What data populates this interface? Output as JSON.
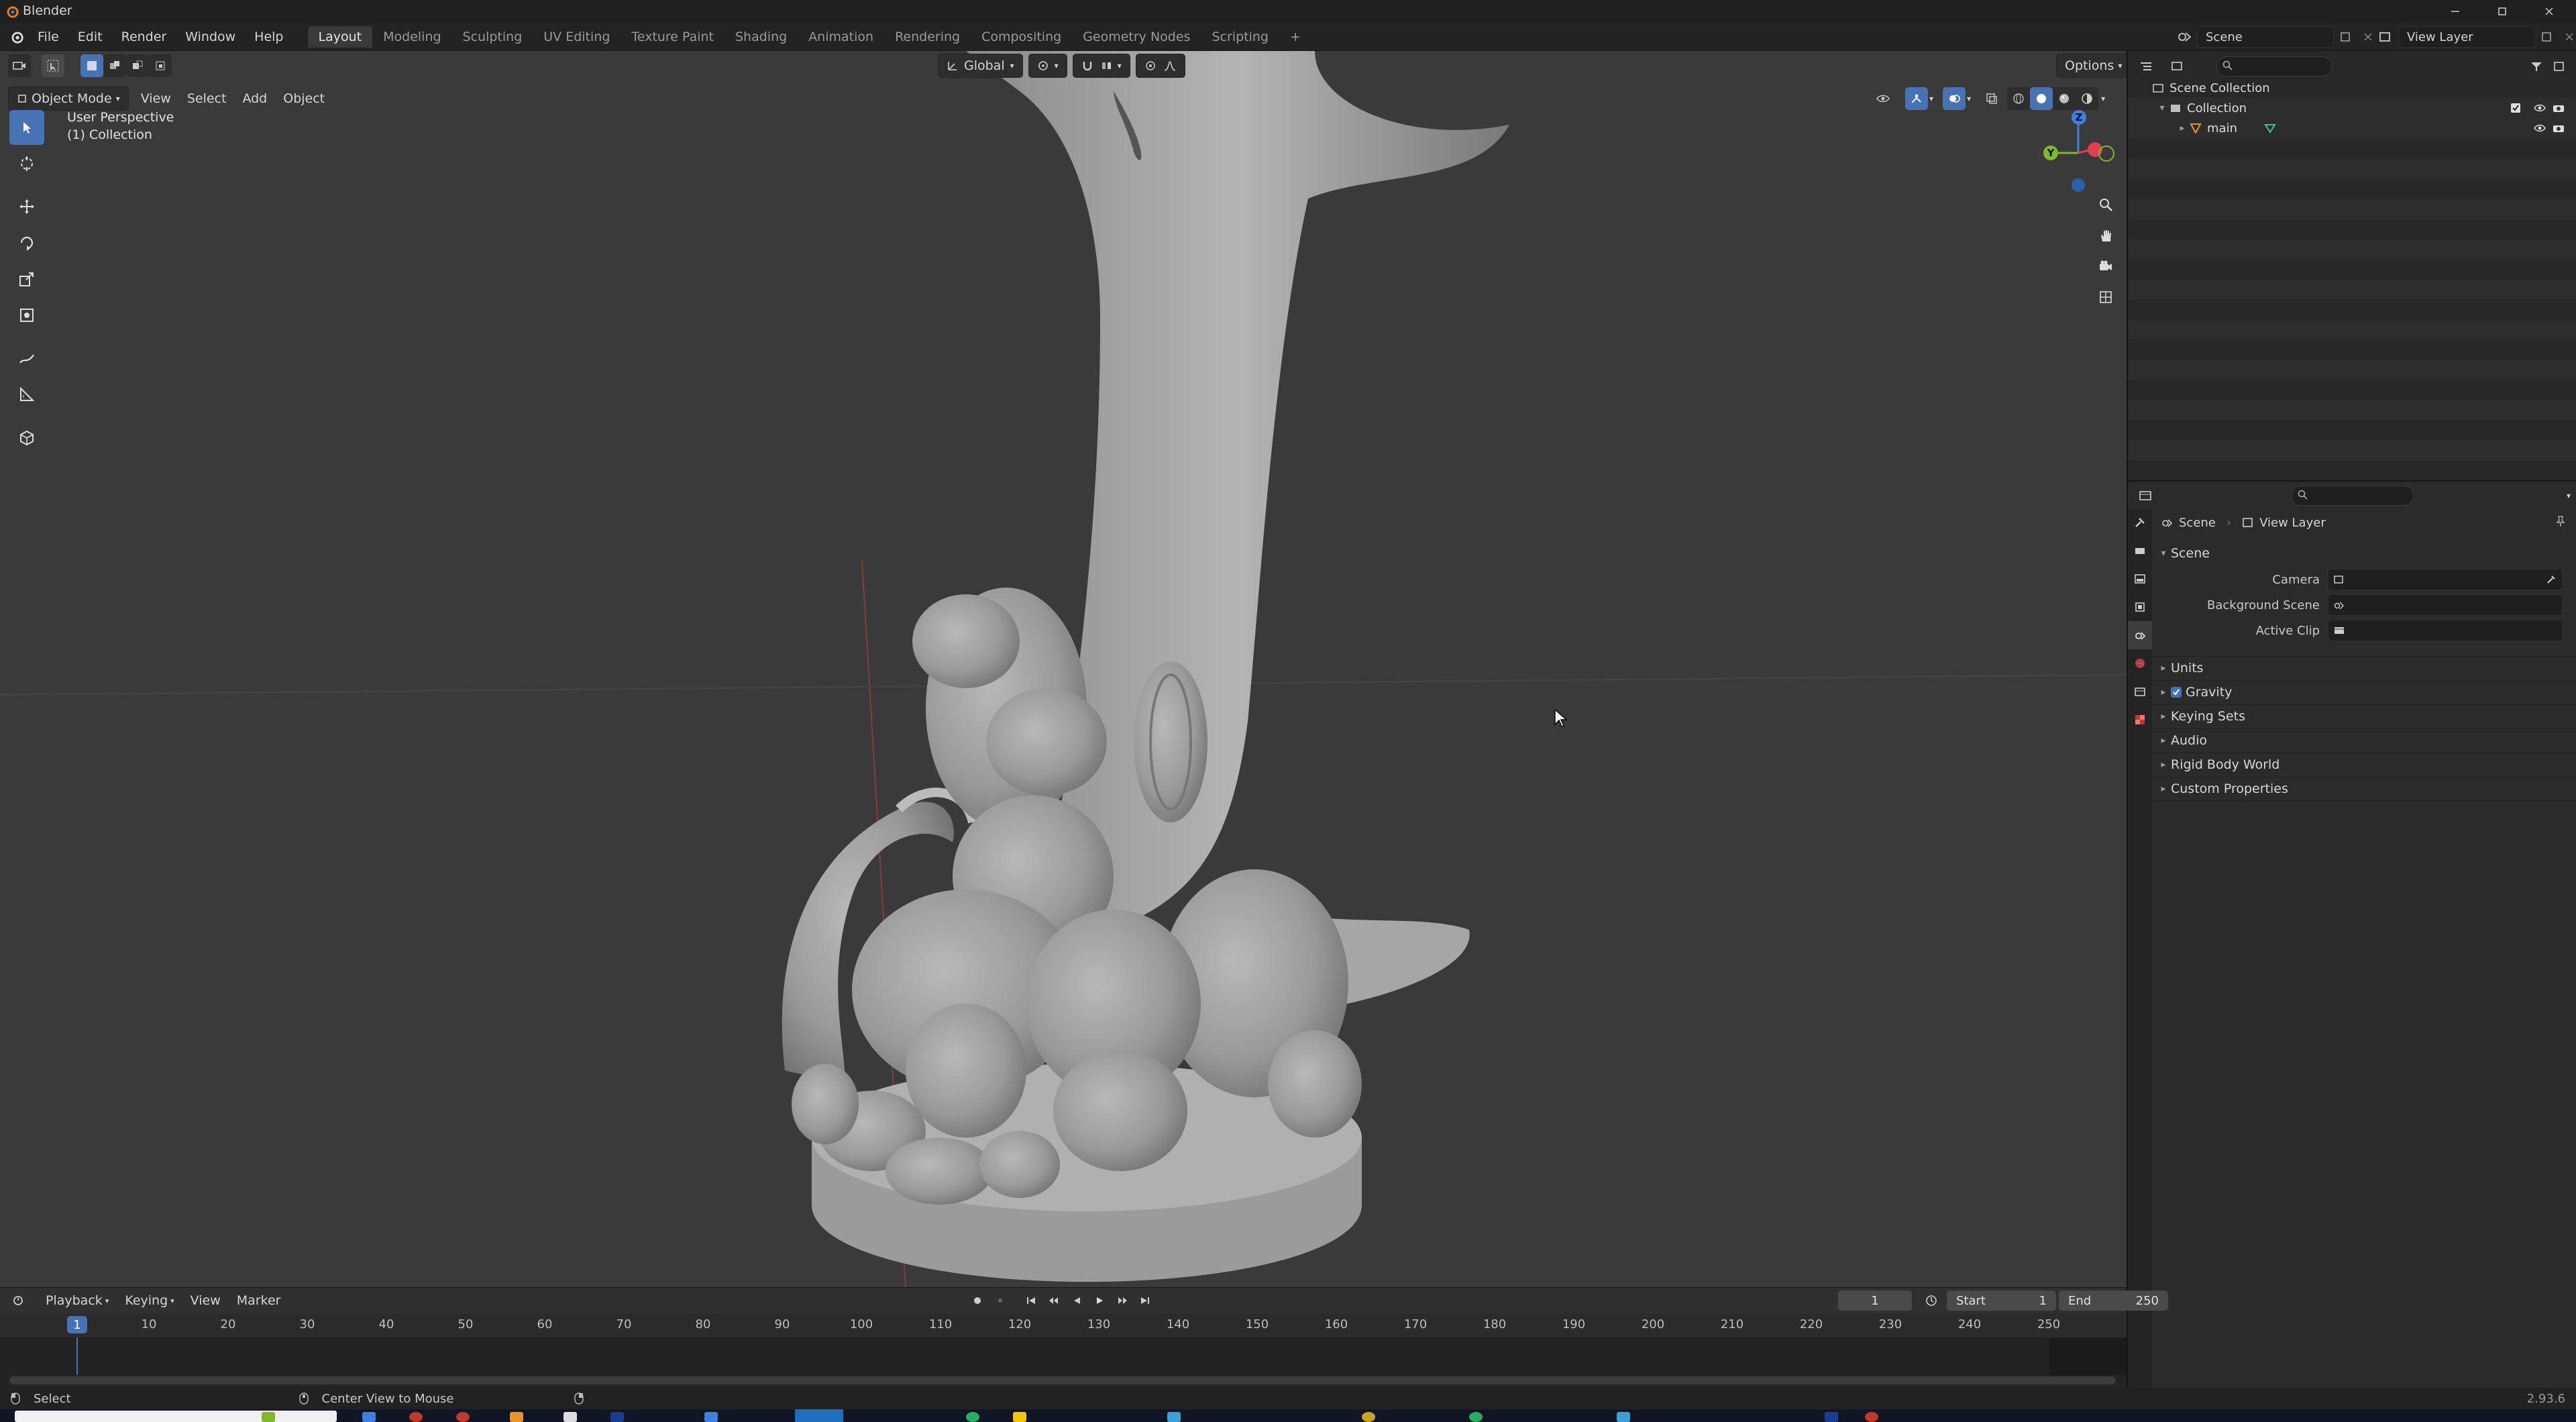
{
  "window": {
    "title": "Blender"
  },
  "menus": [
    "File",
    "Edit",
    "Render",
    "Window",
    "Help"
  ],
  "workspaces": [
    "Layout",
    "Modeling",
    "Sculpting",
    "UV Editing",
    "Texture Paint",
    "Shading",
    "Animation",
    "Rendering",
    "Compositing",
    "Geometry Nodes",
    "Scripting"
  ],
  "active_workspace": "Layout",
  "scene_selector": {
    "scene": "Scene",
    "view_layer": "View Layer"
  },
  "viewport": {
    "mode": "Object Mode",
    "header_menus": [
      "View",
      "Select",
      "Add",
      "Object"
    ],
    "transform_orientation": "Global",
    "options_label": "Options",
    "overlay_text": [
      "User Perspective",
      "(1) Collection"
    ],
    "gizmo_axes": {
      "z": "Z",
      "y": "Y"
    }
  },
  "toolbar_tools": [
    "select-box-icon",
    "cursor-icon",
    "move-icon",
    "rotate-icon",
    "scale-icon",
    "transform-icon",
    "annotate-icon",
    "measure-icon",
    "add-cube-icon"
  ],
  "outliner": {
    "items": [
      {
        "label": "Scene Collection",
        "level": 0
      },
      {
        "label": "Collection",
        "level": 1
      },
      {
        "label": "main",
        "level": 2
      }
    ]
  },
  "properties": {
    "breadcrumb": {
      "scene": "Scene",
      "view_layer": "View Layer"
    },
    "panel_title": "Scene",
    "fields": [
      {
        "label": "Camera",
        "value": ""
      },
      {
        "label": "Background Scene",
        "value": ""
      },
      {
        "label": "Active Clip",
        "value": ""
      }
    ],
    "subpanels": [
      "Units",
      "Gravity",
      "Keying Sets",
      "Audio",
      "Rigid Body World",
      "Custom Properties"
    ],
    "gravity_checked": true
  },
  "timeline": {
    "menus": [
      "Playback",
      "Keying",
      "View",
      "Marker"
    ],
    "current_frame": "1",
    "start_label": "Start",
    "start": "1",
    "end_label": "End",
    "end": "250",
    "ticks": [
      "10",
      "20",
      "30",
      "40",
      "50",
      "60",
      "70",
      "80",
      "90",
      "100",
      "110",
      "120",
      "130",
      "140",
      "150",
      "160",
      "170",
      "180",
      "190",
      "200",
      "210",
      "220",
      "230",
      "240",
      "250"
    ]
  },
  "statusbar": {
    "left": "Select",
    "middle": "Center View to Mouse",
    "version": "2.93.6"
  },
  "colors": {
    "accent": "#4772b3",
    "viewport_bg": "#3a3a3a",
    "axis_x": "#e0404e",
    "axis_y": "#7fb82d",
    "axis_z": "#3d80e0"
  }
}
